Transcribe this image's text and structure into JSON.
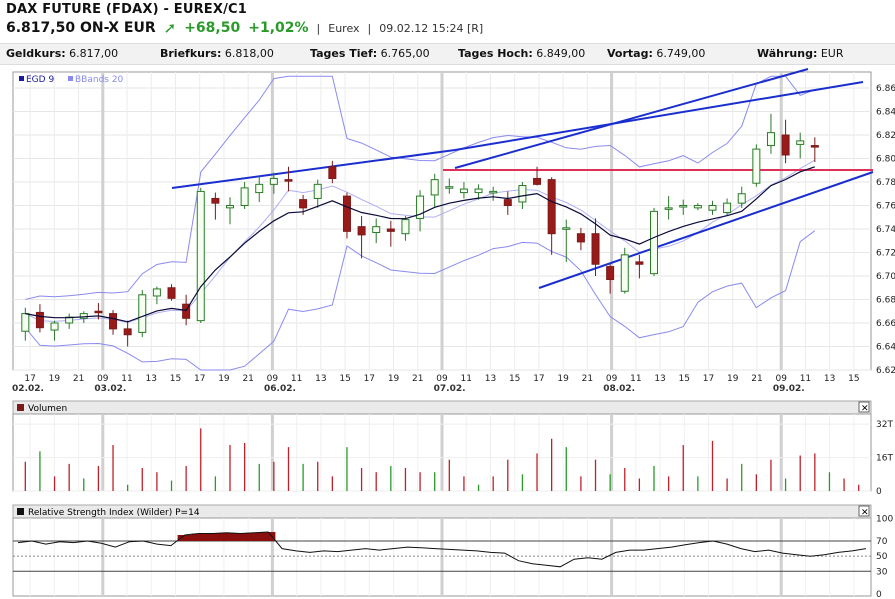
{
  "header": {
    "title": "DAX FUTURE (FDAX) - EUREX/C1",
    "price": "6.817,50 ON-X EUR",
    "change_abs": "+68,50",
    "change_pct": "+1,02%",
    "exchange": "Eurex",
    "timestamp": "09.02.12 15:24 [R]",
    "up_color": "#2a9a2a"
  },
  "quotes": [
    {
      "label": "Geldkurs:",
      "value": "6.817,00"
    },
    {
      "label": "Briefkurs:",
      "value": "6.818,00"
    },
    {
      "label": "Tages Tief:",
      "value": "6.765,00"
    },
    {
      "label": "Tages Hoch:",
      "value": "6.849,00"
    },
    {
      "label": "Vortag:",
      "value": "6.749,00"
    },
    {
      "label": "Währung:",
      "value": "EUR"
    }
  ],
  "main_panel": {
    "legend": [
      "EGD 9",
      "BBands 20"
    ],
    "y_ticks": [
      "6.86",
      "6.84",
      "6.82",
      "6.80",
      "6.78",
      "6.76",
      "6.74",
      "6.72",
      "6.70",
      "6.68",
      "6.66",
      "6.64",
      "6.62"
    ],
    "hour_ticks": [
      "17",
      "19",
      "21",
      "09",
      "11",
      "13",
      "15",
      "17",
      "19",
      "21",
      "09",
      "11",
      "13",
      "15",
      "17",
      "19",
      "21",
      "09",
      "11",
      "13",
      "15",
      "17",
      "19",
      "21",
      "09",
      "11",
      "13",
      "15",
      "17",
      "19",
      "21",
      "09",
      "11",
      "13",
      "15"
    ],
    "date_labels": [
      "02.02.",
      "03.02.",
      "06.02.",
      "07.02.",
      "08.02.",
      "09.02."
    ]
  },
  "volume_panel": {
    "title": "Volumen",
    "y_ticks": [
      "32T",
      "16T",
      "0"
    ]
  },
  "rsi_panel": {
    "title": "Relative Strength Index (Wilder) P=14",
    "y_ticks": [
      "100",
      "70",
      "50",
      "30",
      "0"
    ]
  },
  "chart_data": [
    {
      "type": "candlestick",
      "title": "DAX FUTURE (FDAX) - EUREX/C1",
      "ylim": [
        6.62,
        6.87
      ],
      "bar_count": 58,
      "candles": [
        [
          6.653,
          6.673,
          6.645,
          6.668
        ],
        [
          6.669,
          6.676,
          6.652,
          6.656
        ],
        [
          6.654,
          6.662,
          6.645,
          6.66
        ],
        [
          6.66,
          6.668,
          6.655,
          6.665
        ],
        [
          6.664,
          6.67,
          6.66,
          6.668
        ],
        [
          6.67,
          6.677,
          6.663,
          6.669
        ],
        [
          6.668,
          6.671,
          6.65,
          6.655
        ],
        [
          6.655,
          6.662,
          6.64,
          6.65
        ],
        [
          6.652,
          6.688,
          6.648,
          6.684
        ],
        [
          6.683,
          6.691,
          6.676,
          6.689
        ],
        [
          6.69,
          6.693,
          6.679,
          6.681
        ],
        [
          6.676,
          6.684,
          6.658,
          6.664
        ],
        [
          6.662,
          6.775,
          6.66,
          6.772
        ],
        [
          6.766,
          6.771,
          6.748,
          6.762
        ],
        [
          6.758,
          6.767,
          6.744,
          6.76
        ],
        [
          6.76,
          6.78,
          6.757,
          6.775
        ],
        [
          6.771,
          6.785,
          6.763,
          6.778
        ],
        [
          6.778,
          6.788,
          6.77,
          6.783
        ],
        [
          6.782,
          6.793,
          6.772,
          6.781
        ],
        [
          6.765,
          6.769,
          6.752,
          6.758
        ],
        [
          6.766,
          6.782,
          6.758,
          6.778
        ],
        [
          6.793,
          6.798,
          6.779,
          6.783
        ],
        [
          6.768,
          6.771,
          6.732,
          6.738
        ],
        [
          6.742,
          6.751,
          6.715,
          6.735
        ],
        [
          6.737,
          6.749,
          6.728,
          6.742
        ],
        [
          6.74,
          6.747,
          6.725,
          6.738
        ],
        [
          6.736,
          6.751,
          6.73,
          6.748
        ],
        [
          6.749,
          6.773,
          6.738,
          6.768
        ],
        [
          6.769,
          6.787,
          6.758,
          6.782
        ],
        [
          6.776,
          6.783,
          6.77,
          6.776
        ],
        [
          6.771,
          6.78,
          6.766,
          6.774
        ],
        [
          6.771,
          6.778,
          6.765,
          6.774
        ],
        [
          6.771,
          6.776,
          6.764,
          6.772
        ],
        [
          6.765,
          6.772,
          6.752,
          6.76
        ],
        [
          6.763,
          6.78,
          6.757,
          6.777
        ],
        [
          6.783,
          6.793,
          6.777,
          6.778
        ],
        [
          6.782,
          6.784,
          6.718,
          6.736
        ],
        [
          6.74,
          6.748,
          6.712,
          6.741
        ],
        [
          6.736,
          6.741,
          6.722,
          6.729
        ],
        [
          6.736,
          6.749,
          6.7,
          6.71
        ],
        [
          6.708,
          6.71,
          6.685,
          6.697
        ],
        [
          6.687,
          6.724,
          6.685,
          6.718
        ],
        [
          6.712,
          6.718,
          6.698,
          6.71
        ],
        [
          6.702,
          6.758,
          6.7,
          6.755
        ],
        [
          6.757,
          6.768,
          6.748,
          6.758
        ],
        [
          6.76,
          6.765,
          6.752,
          6.76
        ],
        [
          6.758,
          6.762,
          6.756,
          6.76
        ],
        [
          6.756,
          6.764,
          6.752,
          6.76
        ],
        [
          6.754,
          6.766,
          6.752,
          6.762
        ],
        [
          6.762,
          6.776,
          6.758,
          6.77
        ],
        [
          6.779,
          6.812,
          6.776,
          6.808
        ],
        [
          6.811,
          6.838,
          6.804,
          6.822
        ],
        [
          6.82,
          6.833,
          6.796,
          6.803
        ],
        [
          6.812,
          6.822,
          6.8,
          6.815
        ],
        [
          6.811,
          6.818,
          6.797,
          6.81
        ]
      ]
    },
    {
      "type": "bar",
      "title": "Volumen",
      "ylim": [
        0,
        34000
      ],
      "values": [
        14000,
        19000,
        7000,
        13000,
        6000,
        12000,
        22000,
        3000,
        11000,
        9000,
        5000,
        12000,
        30000,
        7000,
        22000,
        23000,
        13000,
        14000,
        21000,
        13000,
        14000,
        7000,
        21000,
        11000,
        9000,
        12000,
        11000,
        9000,
        9000,
        15000,
        7000,
        3000,
        7000,
        15000,
        8000,
        18000,
        25000,
        21000,
        7000,
        15000,
        8000,
        11000,
        6000,
        12000,
        7000,
        22000,
        7000,
        24000,
        6000,
        13000,
        8000,
        15000,
        6000,
        17000,
        18000,
        9000,
        6000,
        3000
      ]
    },
    {
      "type": "line",
      "title": "Relative Strength Index (Wilder) P=14",
      "ylim": [
        0,
        100
      ],
      "values": [
        68,
        70,
        66,
        69,
        68,
        70,
        67,
        62,
        69,
        70,
        66,
        64,
        78,
        80,
        80,
        81,
        80,
        81,
        82,
        60,
        57,
        55,
        57,
        56,
        58,
        60,
        58,
        60,
        62,
        61,
        60,
        59,
        58,
        57,
        55,
        54,
        44,
        40,
        38,
        36,
        46,
        48,
        46,
        55,
        58,
        58,
        60,
        62,
        65,
        68,
        70,
        66,
        60,
        56,
        58,
        54,
        52,
        50,
        52,
        55,
        57,
        60
      ]
    }
  ]
}
